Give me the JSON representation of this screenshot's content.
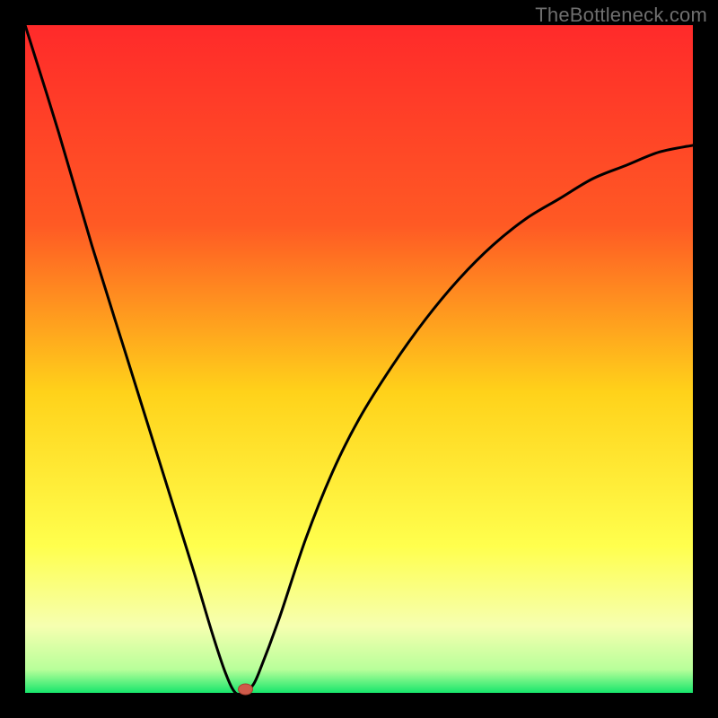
{
  "watermark": "TheBottleneck.com",
  "colors": {
    "background": "#000000",
    "gradient_top": "#ff2a2a",
    "gradient_mid1": "#ff7a1f",
    "gradient_mid2": "#ffd21a",
    "gradient_mid3": "#ffff66",
    "gradient_bottom": "#17e66b",
    "curve": "#000000",
    "dot_fill": "#cf5a4a",
    "dot_stroke": "#a84030"
  },
  "chart_data": {
    "type": "line",
    "title": "",
    "xlabel": "",
    "ylabel": "",
    "xlim": [
      0,
      100
    ],
    "ylim": [
      0,
      100
    ],
    "x": [
      0,
      5,
      10,
      15,
      20,
      25,
      28,
      30,
      31.5,
      33,
      34,
      35,
      38,
      42,
      46,
      50,
      55,
      60,
      65,
      70,
      75,
      80,
      85,
      90,
      95,
      100
    ],
    "values": [
      100,
      84,
      67,
      51,
      35,
      19,
      9,
      3,
      0,
      0,
      1,
      3,
      11,
      23,
      33,
      41,
      49,
      56,
      62,
      67,
      71,
      74,
      77,
      79,
      81,
      82
    ],
    "annotations": [
      {
        "type": "dot",
        "x": 33,
        "y": 0
      }
    ]
  }
}
